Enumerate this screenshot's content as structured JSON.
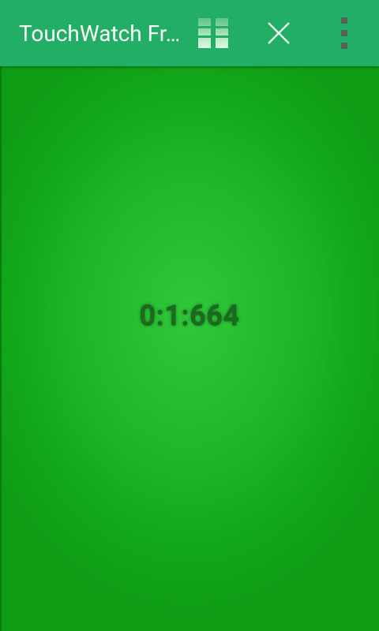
{
  "app": {
    "title": "TouchWatch Fr…",
    "accent_color": "#22ae65",
    "background_color": "#1fb82a"
  },
  "toolbar": {
    "pause_icon": "pause-icon",
    "close_icon": "close-icon",
    "menu_icon": "more-vert-icon"
  },
  "stopwatch": {
    "elapsed": "0:1:664"
  }
}
